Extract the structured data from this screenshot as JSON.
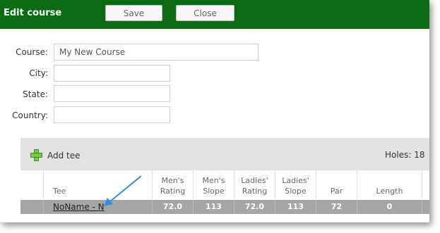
{
  "title": "Edit course",
  "buttons": {
    "save": "Save",
    "close": "Close"
  },
  "form": {
    "course_label": "Course:",
    "course_value": "My New Course",
    "city_label": "City:",
    "city_value": "",
    "state_label": "State:",
    "state_value": "",
    "country_label": "Country:",
    "country_value": ""
  },
  "tees": {
    "add_label": "Add tee",
    "holes_text": "Holes: 18",
    "columns": [
      "Tee",
      "Men's Rating",
      "Men's Slope",
      "Ladies' Rating",
      "Ladies' Slope",
      "Par",
      "Length"
    ],
    "rows": [
      {
        "name": "NoName - N",
        "mens_rating": "72.0",
        "mens_slope": "113",
        "ladies_rating": "72.0",
        "ladies_slope": "113",
        "par": "72",
        "length": "0"
      }
    ]
  },
  "colors": {
    "titlebar": "#0b6b12",
    "arrow": "#2f8fe0",
    "selected_row": "#a6a6a6"
  },
  "icons": {
    "add": "plus-icon"
  }
}
